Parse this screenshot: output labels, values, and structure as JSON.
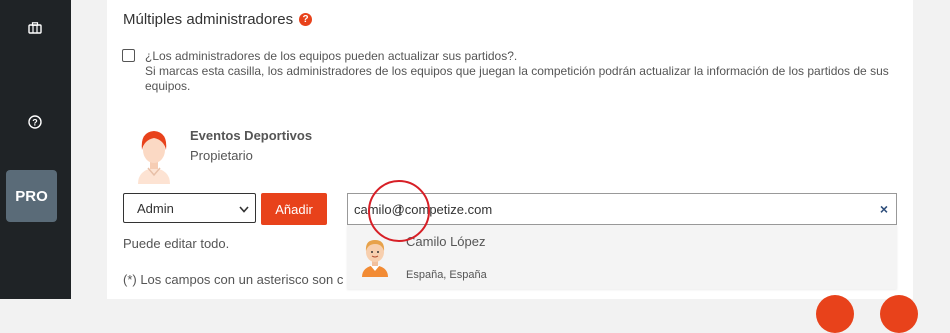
{
  "sidebar": {
    "pro_label": "PRO"
  },
  "section": {
    "title": "Múltiples administradores",
    "help_icon": "?"
  },
  "checkbox": {
    "checked": false,
    "line1": "¿Los administradores de los equipos pueden actualizar sus partidos?.",
    "line2": "Si marcas esta casilla, los administradores de los equipos que juegan la competición podrán actualizar la información de los partidos de sus equipos."
  },
  "owner": {
    "name": "Eventos Deportivos",
    "role": "Propietario"
  },
  "role_select": {
    "value": "Admin",
    "options": [
      "Admin"
    ]
  },
  "add_button": {
    "label": "Añadir"
  },
  "email_input": {
    "value": "camilo@competize.com",
    "clear_icon": "×"
  },
  "role_hint": "Puede editar todo.",
  "required_note": "(*) Los campos con un asterisco son c",
  "suggestion": {
    "name": "Camilo López",
    "location": "España, España"
  },
  "colors": {
    "accent": "#e8421b",
    "sidebar": "#1f2326",
    "pro": "#5a6b78",
    "highlight": "#d71f26"
  }
}
